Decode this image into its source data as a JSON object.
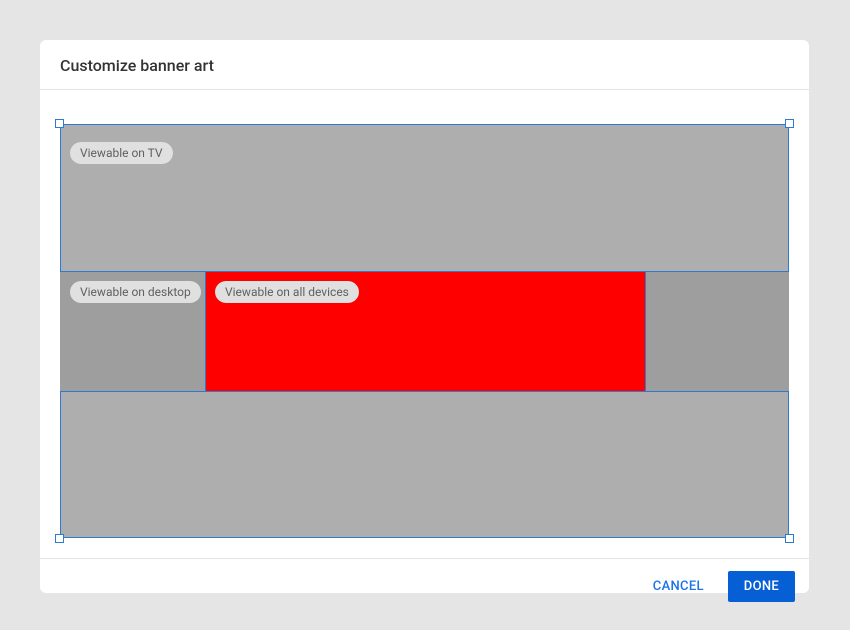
{
  "dialog": {
    "title": "Customize banner art"
  },
  "zones": {
    "tv_label": "Viewable on TV",
    "desktop_label": "Viewable on desktop",
    "all_devices_label": "Viewable on all devices"
  },
  "actions": {
    "cancel": "CANCEL",
    "done": "DONE"
  },
  "colors": {
    "accent": "#065fd4",
    "crop_border": "#2e7ad1",
    "safe_zone_bg": "#ff0000",
    "tv_bg": "#aeaeae",
    "desktop_bg": "#9e9e9e"
  }
}
